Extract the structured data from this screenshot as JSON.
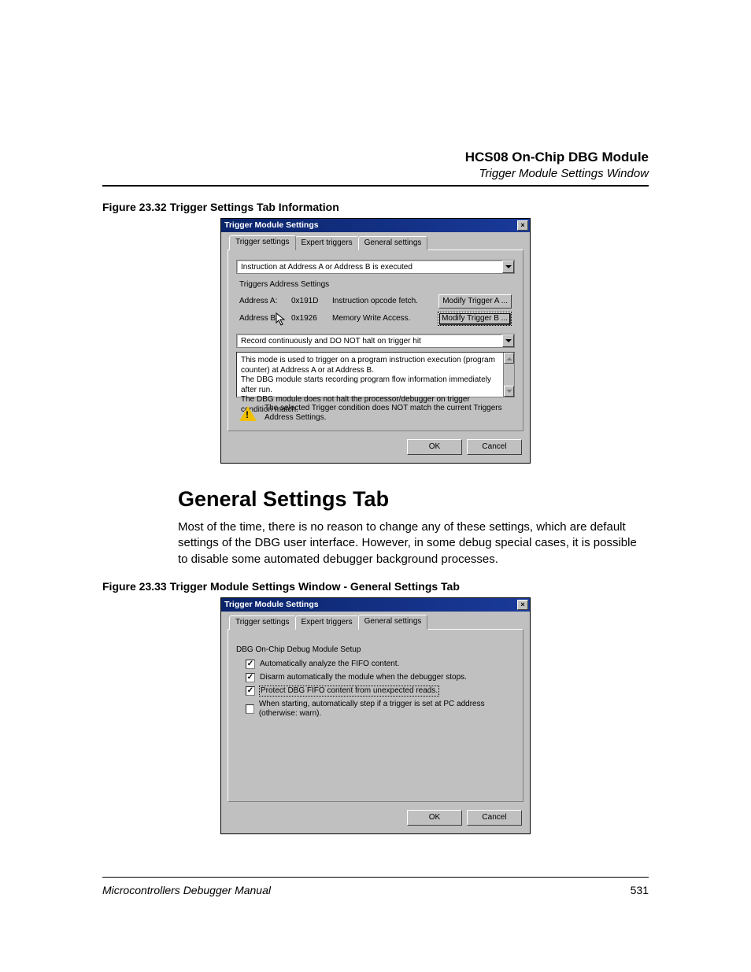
{
  "header": {
    "title": "HCS08 On-Chip DBG Module",
    "subtitle": "Trigger Module Settings Window"
  },
  "fig1_caption": "Figure 23.32  Trigger Settings Tab Information",
  "dialog1": {
    "title": "Trigger Module Settings",
    "tabs": [
      "Trigger settings",
      "Expert triggers",
      "General settings"
    ],
    "active_tab": 0,
    "combo1": "Instruction at Address A or Address B is executed",
    "group_label": "Triggers Address Settings",
    "addr_a_label": "Address A:",
    "addr_a_val": "0x191D",
    "addr_a_desc": "Instruction opcode fetch.",
    "addr_b_label": "Address B:",
    "addr_b_val": "0x1926",
    "addr_b_desc": "Memory Write Access.",
    "modify_a": "Modify Trigger A ...",
    "modify_b": "Modify Trigger B ...",
    "combo2": "Record continuously and DO NOT halt on trigger hit",
    "info_text": "This mode is used to trigger on a program instruction execution (program counter) at Address A or at Address B.\nThe DBG module starts recording program flow information immediately after run.\nThe DBG module does not halt the processor/debugger on trigger condition match.",
    "warning": "The selected Trigger condition does NOT match the current Triggers Address Settings.",
    "ok": "OK",
    "cancel": "Cancel"
  },
  "section": {
    "heading": "General Settings Tab",
    "para": "Most of the time, there is no reason to change any of these settings, which are default settings of the DBG user interface. However, in some debug special cases, it is possible to disable some automated debugger background processes."
  },
  "fig2_caption": "Figure 23.33  Trigger Module Settings Window - General Settings Tab",
  "dialog2": {
    "title": "Trigger Module Settings",
    "tabs": [
      "Trigger settings",
      "Expert triggers",
      "General settings"
    ],
    "active_tab": 2,
    "group_label": "DBG On-Chip Debug Module Setup",
    "checks": [
      {
        "checked": true,
        "label": "Automatically analyze the FIFO content."
      },
      {
        "checked": true,
        "label": "Disarm automatically the module when the debugger stops."
      },
      {
        "checked": true,
        "label": "Protect DBG FIFO content from unexpected reads.",
        "focused": true
      },
      {
        "checked": false,
        "label": "When starting, automatically step if a trigger is set at PC address (otherwise: warn)."
      }
    ],
    "ok": "OK",
    "cancel": "Cancel"
  },
  "footer": {
    "left": "Microcontrollers Debugger Manual",
    "page": "531"
  }
}
